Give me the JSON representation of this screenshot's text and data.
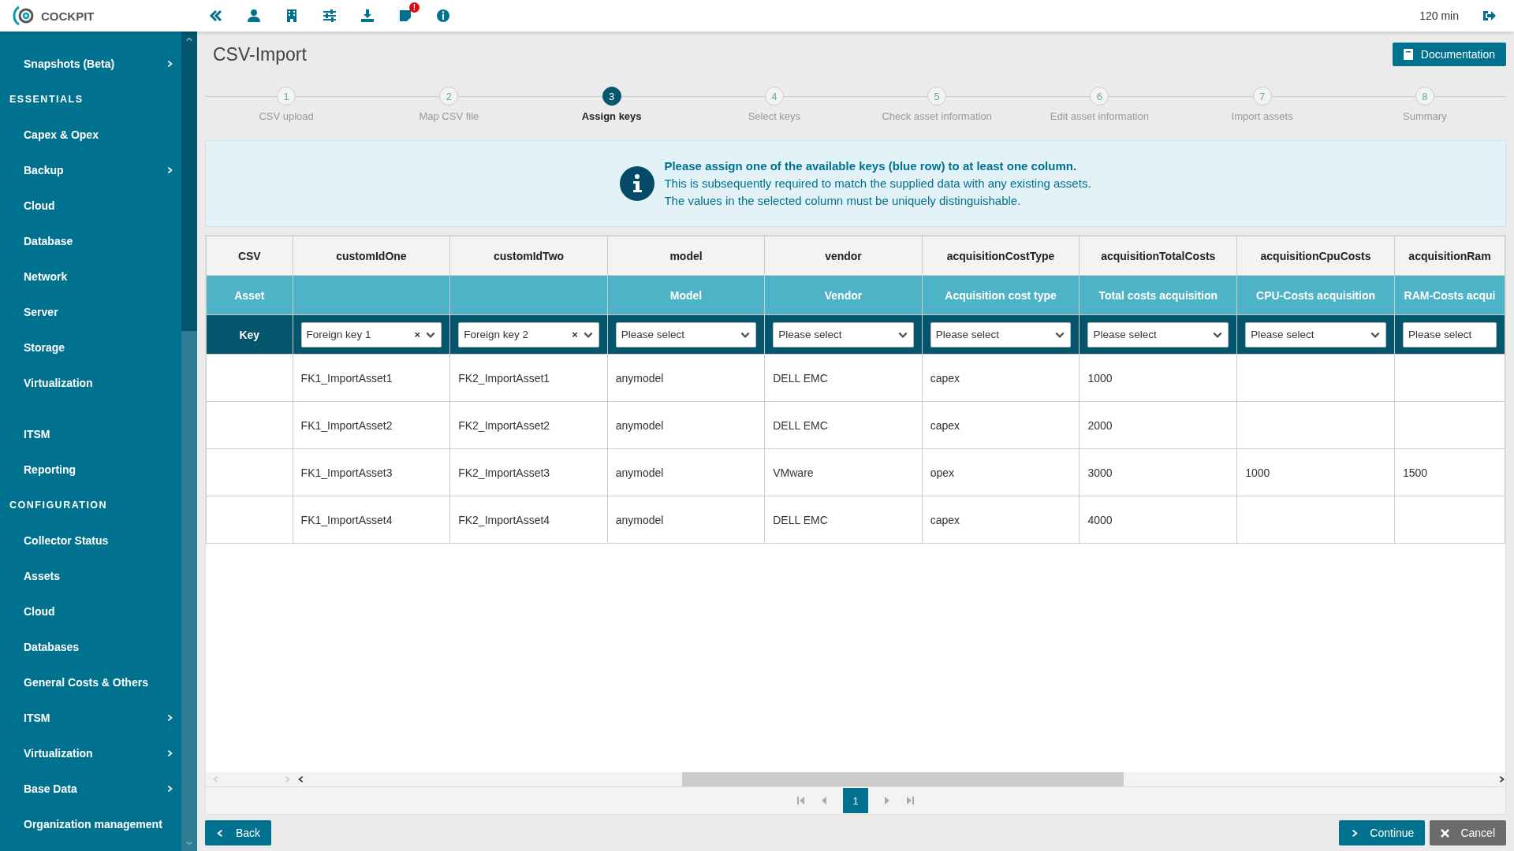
{
  "header": {
    "logo": "COCKPIT",
    "notification_badge": "!",
    "session": "120 min"
  },
  "sidebar": {
    "items": [
      {
        "kind": "item",
        "label": "Snapshots (Beta)",
        "has_children": true
      },
      {
        "kind": "section",
        "label": "ESSENTIALS"
      },
      {
        "kind": "item",
        "label": "Capex & Opex",
        "has_children": false
      },
      {
        "kind": "item",
        "label": "Backup",
        "has_children": true
      },
      {
        "kind": "item",
        "label": "Cloud",
        "has_children": false
      },
      {
        "kind": "item",
        "label": "Database",
        "has_children": false
      },
      {
        "kind": "item",
        "label": "Network",
        "has_children": false
      },
      {
        "kind": "item",
        "label": "Server",
        "has_children": false
      },
      {
        "kind": "item",
        "label": "Storage",
        "has_children": false
      },
      {
        "kind": "item",
        "label": "Virtualization",
        "has_children": false
      },
      {
        "kind": "spacer"
      },
      {
        "kind": "item",
        "label": "ITSM",
        "has_children": false
      },
      {
        "kind": "item",
        "label": "Reporting",
        "has_children": false
      },
      {
        "kind": "section",
        "label": "CONFIGURATION"
      },
      {
        "kind": "item",
        "label": "Collector Status",
        "has_children": false
      },
      {
        "kind": "item",
        "label": "Assets",
        "has_children": false
      },
      {
        "kind": "item",
        "label": "Cloud",
        "has_children": false
      },
      {
        "kind": "item",
        "label": "Databases",
        "has_children": false
      },
      {
        "kind": "item",
        "label": "General Costs & Others",
        "has_children": false
      },
      {
        "kind": "item",
        "label": "ITSM",
        "has_children": true
      },
      {
        "kind": "item",
        "label": "Virtualization",
        "has_children": true
      },
      {
        "kind": "item",
        "label": "Base Data",
        "has_children": true
      },
      {
        "kind": "item",
        "label": "Organization management",
        "has_children": false
      }
    ]
  },
  "page": {
    "title": "CSV-Import",
    "documentation_button": "Documentation"
  },
  "steps": [
    {
      "number": "1",
      "label": "CSV upload",
      "selected": false
    },
    {
      "number": "2",
      "label": "Map CSV file",
      "selected": false
    },
    {
      "number": "3",
      "label": "Assign keys",
      "selected": true
    },
    {
      "number": "4",
      "label": "Select keys",
      "selected": false
    },
    {
      "number": "5",
      "label": "Check asset information",
      "selected": false
    },
    {
      "number": "6",
      "label": "Edit asset information",
      "selected": false
    },
    {
      "number": "7",
      "label": "Import assets",
      "selected": false
    },
    {
      "number": "8",
      "label": "Summary",
      "selected": false
    }
  ],
  "info": {
    "heading": "Please assign one of the available keys (blue row) to at least one column.",
    "lines": [
      "This is subsequently required to match the supplied data with any existing assets.",
      "The values in the selected column must be uniquely distinguishable."
    ]
  },
  "table": {
    "row_labels": {
      "csv": "CSV",
      "asset": "Asset",
      "key": "Key"
    },
    "columns": [
      {
        "csv": "customIdOne",
        "key": "Foreign key 1",
        "clear": "×"
      },
      {
        "csv": "customIdTwo",
        "key": "Foreign key 2",
        "clear": "×"
      },
      {
        "csv": "model",
        "asset": "Model",
        "key": "Please select"
      },
      {
        "csv": "vendor",
        "asset": "Vendor",
        "key": "Please select"
      },
      {
        "csv": "acquisitionCostType",
        "asset": "Acquisition cost type",
        "key": "Please select"
      },
      {
        "csv": "acquisitionTotalCosts",
        "asset": "Total costs acquisition",
        "key": "Please select"
      },
      {
        "csv": "acquisitionCpuCosts",
        "asset": "CPU-Costs acquisition",
        "key": "Please select"
      },
      {
        "csv": "acquisitionRam",
        "asset": "RAM-Costs acqui",
        "key": "Please select"
      }
    ],
    "rows": [
      [
        "FK1_ImportAsset1",
        "FK2_ImportAsset1",
        "anymodel",
        "DELL EMC",
        "capex",
        "1000",
        "",
        ""
      ],
      [
        "FK1_ImportAsset2",
        "FK2_ImportAsset2",
        "anymodel",
        "DELL EMC",
        "capex",
        "2000",
        "",
        ""
      ],
      [
        "FK1_ImportAsset3",
        "FK2_ImportAsset3",
        "anymodel",
        "VMware",
        "opex",
        "3000",
        "1000",
        "1500"
      ],
      [
        "FK1_ImportAsset4",
        "FK2_ImportAsset4",
        "anymodel",
        "DELL EMC",
        "capex",
        "4000",
        "",
        ""
      ]
    ]
  },
  "pagination": {
    "current_page": "1"
  },
  "buttons": {
    "back": "Back",
    "continue": "Continue",
    "cancel": "Cancel"
  }
}
